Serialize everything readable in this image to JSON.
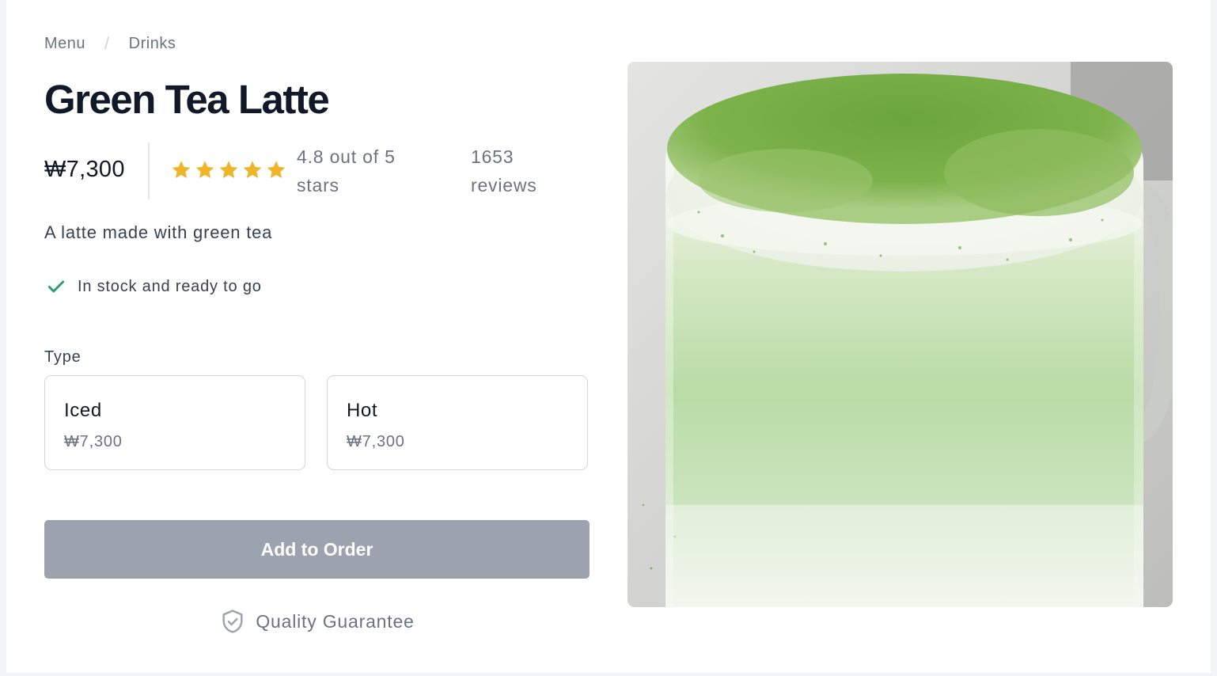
{
  "breadcrumb": {
    "items": [
      "Menu",
      "Drinks"
    ],
    "separator": "/"
  },
  "product": {
    "title": "Green Tea Latte",
    "price": "₩7,300",
    "rating_value": 4.8,
    "rating_text": "4.8 out of 5 stars",
    "reviews_text": "1653 reviews",
    "description": "A latte made with green tea",
    "stock_status": "In stock and ready to go"
  },
  "type_selector": {
    "label": "Type",
    "options": [
      {
        "name": "Iced",
        "price": "₩7,300"
      },
      {
        "name": "Hot",
        "price": "₩7,300"
      }
    ]
  },
  "actions": {
    "add_to_order": "Add to Order"
  },
  "guarantee": {
    "label": "Quality Guarantee",
    "icon": "shield-check-icon"
  },
  "image": {
    "subject": "green-tea-latte-photo"
  },
  "colors": {
    "star_filled": "#f0b429",
    "star_empty": "#9ca3af",
    "check": "#22a06b",
    "button_disabled": "#9ca3af"
  },
  "icons": {
    "stock": "check-icon",
    "star": "star-icon"
  }
}
